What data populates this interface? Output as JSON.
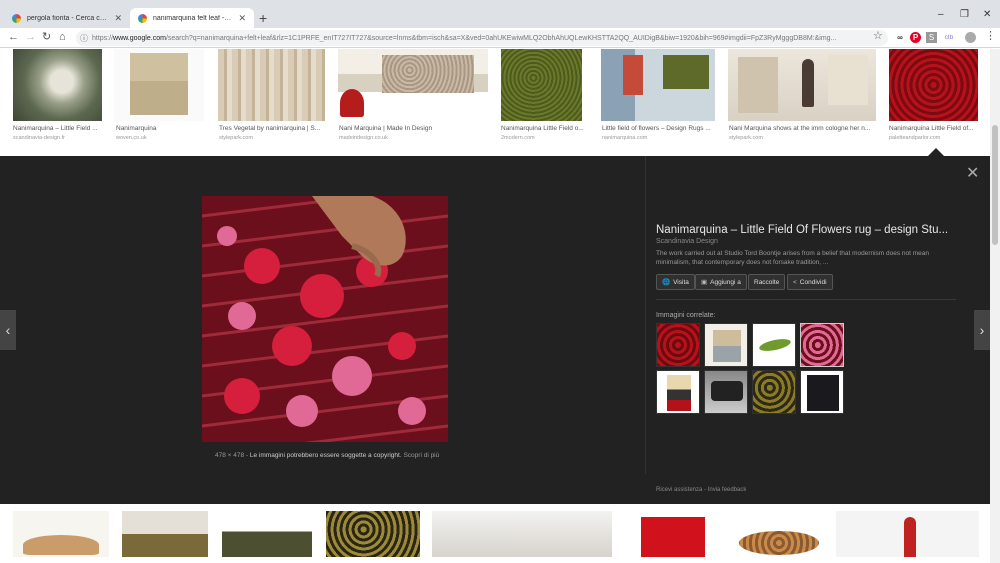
{
  "tabs": [
    {
      "title": "pergola fiorita - Cerca con Goog",
      "close": "✕"
    },
    {
      "title": "nanimarquina felt leaf - Cerca co",
      "close": "✕"
    }
  ],
  "new_tab": "+",
  "window": {
    "minimize": "–",
    "maximize": "❐",
    "close": "✕"
  },
  "toolbar": {
    "back": "←",
    "forward": "→",
    "reload": "↻",
    "home": "⌂",
    "info": "ⓘ",
    "url_scheme": "https://",
    "url_host": "www.google.com",
    "url_rest": "/search?q=nanimarquina+felt+leaf&rlz=1C1PRFE_enIT727IT727&source=lnms&tbm=isch&sa=X&ved=0ahUKEwiwMLQ2ObhAhUQLewKHSTTA2QQ_AUIDigB&biw=1920&bih=969#imgdii=FpZ3RyMgggDB8M:&img...",
    "star": "☆",
    "ext_labels": [
      "∞",
      "P",
      "S",
      "ctb"
    ],
    "menu": "⋮"
  },
  "top_results": [
    {
      "caption": "Nanimarquina – Little Field ...",
      "source": "scandinavia-design.fr"
    },
    {
      "caption": "Nanimarquina",
      "source": "woven.co.uk"
    },
    {
      "caption": "Tres Vegetal by nanimarquina | S...",
      "source": "stylepark.com"
    },
    {
      "caption": "Nani Marquina | Made In Design",
      "source": "madeindesign.co.uk"
    },
    {
      "caption": "Nanimarquina Little Field o...",
      "source": "2modern.com"
    },
    {
      "caption": "Little field of flowers – Design Rugs ...",
      "source": "nanimarquina.com"
    },
    {
      "caption": "Nani Marquina shows at the imm cologne her n...",
      "source": "stylepark.com"
    },
    {
      "caption": "Nanimarquina Little Field of...",
      "source": "paletteandparlor.com"
    }
  ],
  "viewer": {
    "close": "✕",
    "prev": "‹",
    "next": "›",
    "dimensions": "478 × 478",
    "separator": " - ",
    "disclaimer": "Le immagini potrebbero essere soggette a copyright.",
    "learn_more": "Scopri di più",
    "title": "Nanimarquina – Little Field Of Flowers rug – design Stu...",
    "site": "Scandinavia Design",
    "description": "The work carried out at Studio Tord Boontje arises from a belief that modernism does not mean minimalism, that contemporary does not forsake tradition, ...",
    "buttons": [
      {
        "icon": "🌐",
        "label": "Visita"
      },
      {
        "icon": "▣",
        "label": "Aggiungi a"
      },
      {
        "icon": "",
        "label": "Raccolte"
      },
      {
        "icon": "<",
        "label": "Condividi"
      }
    ],
    "related_label": "Immagini correlate:",
    "footer_help": "Ricevi assistenza",
    "footer_dash": " - ",
    "footer_feedback": "Invia feedback"
  },
  "colors": {
    "accent_red": "#c8102e",
    "panel_bg": "#222222"
  }
}
